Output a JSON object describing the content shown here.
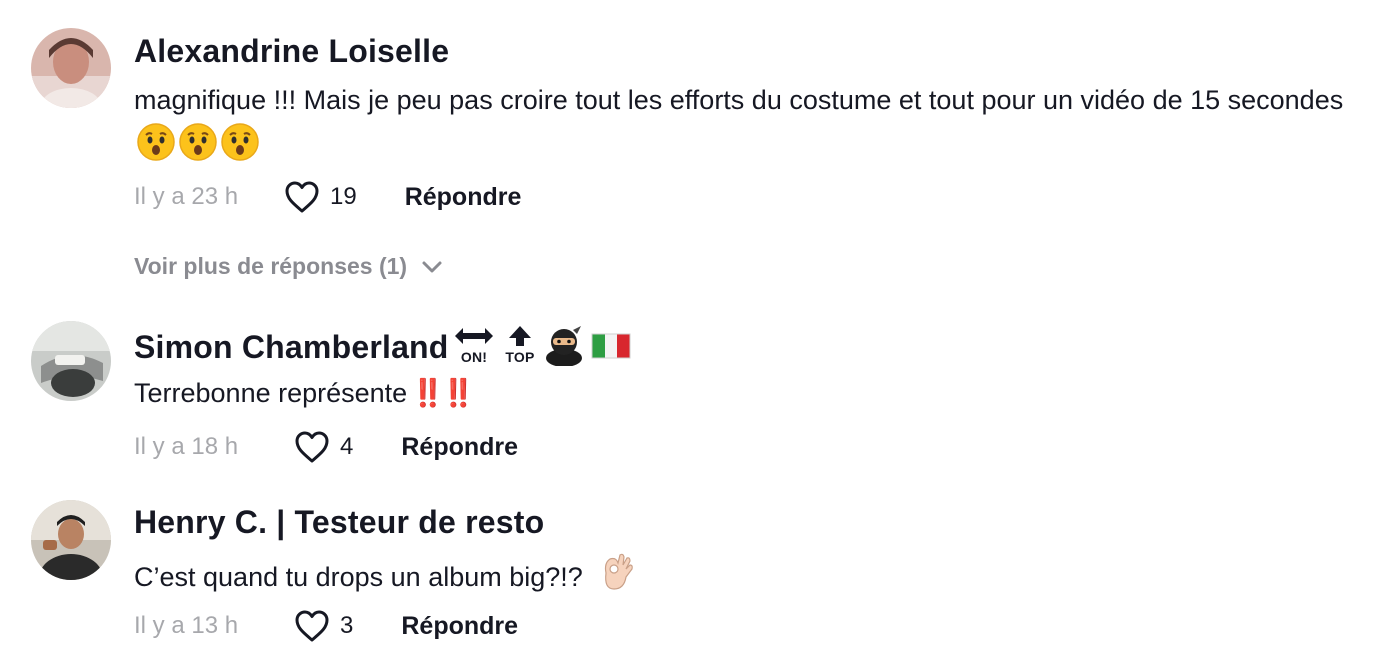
{
  "comments": [
    {
      "username": "Alexandrine Loiselle",
      "text": "magnifique !!! Mais je peu pas croire tout les efforts du costume et tout pour un vidéo de 15 secondes",
      "emojis": [
        "astonished-face-emoji",
        "astonished-face-emoji",
        "astonished-face-emoji"
      ],
      "time": "Il y a 23 h",
      "likes": "19",
      "reply_label": "Répondre",
      "more_replies": "Voir plus de réponses (1)"
    },
    {
      "username": "Simon Chamberland",
      "username_emojis": [
        "on-arrow-emoji",
        "top-arrow-emoji",
        "ninja-emoji",
        "italy-flag-emoji"
      ],
      "on_label": "ON!",
      "top_label": "TOP",
      "text": "Terrebonne représente",
      "text_suffix": "‼️‼️",
      "time": "Il y a 18 h",
      "likes": "4",
      "reply_label": "Répondre"
    },
    {
      "username": "Henry C. | Testeur de resto",
      "text": "C’est quand tu drops un album big?!?",
      "emojis": [
        "ok-hand-emoji"
      ],
      "time": "Il y a 13 h",
      "likes": "3",
      "reply_label": "Répondre"
    }
  ],
  "colors": {
    "text": "#161823",
    "muted": "#a7a8ac",
    "accent_red": "#e0211c"
  }
}
